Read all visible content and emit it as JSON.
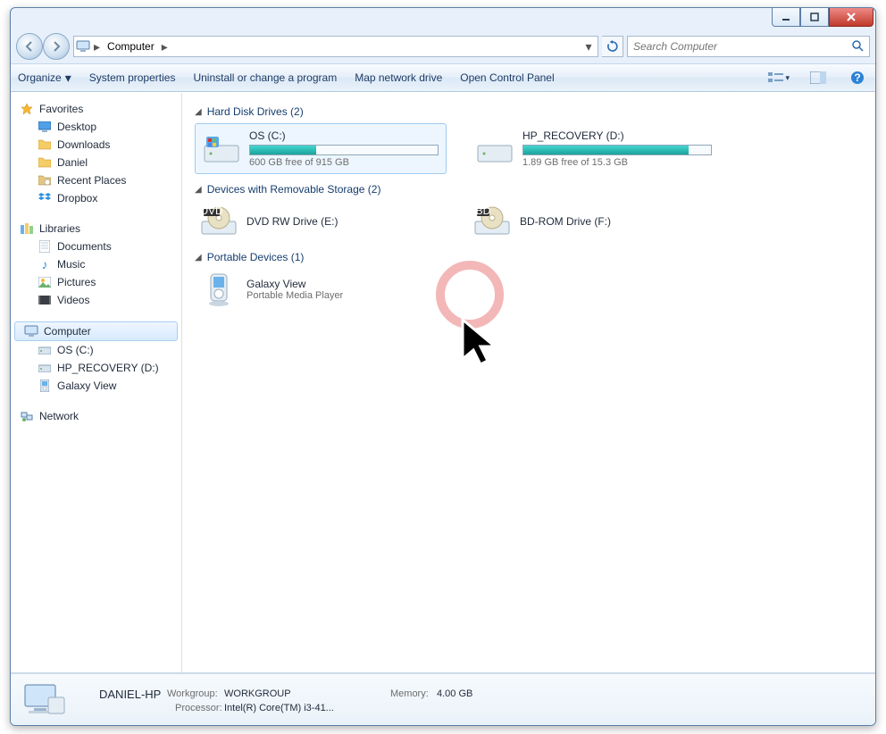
{
  "breadcrumb": {
    "root": "Computer"
  },
  "search": {
    "placeholder": "Search Computer"
  },
  "toolbar": {
    "organize": "Organize",
    "system_properties": "System properties",
    "uninstall": "Uninstall or change a program",
    "map_drive": "Map network drive",
    "control_panel": "Open Control Panel"
  },
  "sidebar": {
    "favorites": {
      "label": "Favorites",
      "items": [
        {
          "label": "Desktop",
          "icon": "desktop"
        },
        {
          "label": "Downloads",
          "icon": "folder"
        },
        {
          "label": "Daniel",
          "icon": "folder"
        },
        {
          "label": "Recent Places",
          "icon": "recent"
        },
        {
          "label": "Dropbox",
          "icon": "dropbox"
        }
      ]
    },
    "libraries": {
      "label": "Libraries",
      "items": [
        {
          "label": "Documents",
          "icon": "documents"
        },
        {
          "label": "Music",
          "icon": "music"
        },
        {
          "label": "Pictures",
          "icon": "pictures"
        },
        {
          "label": "Videos",
          "icon": "videos"
        }
      ]
    },
    "computer": {
      "label": "Computer",
      "items": [
        {
          "label": "OS (C:)",
          "icon": "hdd"
        },
        {
          "label": "HP_RECOVERY (D:)",
          "icon": "hdd"
        },
        {
          "label": "Galaxy View",
          "icon": "media-player"
        }
      ]
    },
    "network": {
      "label": "Network"
    }
  },
  "sections": {
    "hdd": {
      "title": "Hard Disk Drives (2)"
    },
    "removable": {
      "title": "Devices with Removable Storage (2)"
    },
    "portable": {
      "title": "Portable Devices (1)"
    }
  },
  "drives": {
    "os": {
      "title": "OS (C:)",
      "sub": "600 GB free of 915 GB",
      "fill_pct": 35
    },
    "recovery": {
      "title": "HP_RECOVERY (D:)",
      "sub": "1.89 GB free of 15.3 GB",
      "fill_pct": 88
    }
  },
  "removable": {
    "dvd": {
      "title": "DVD RW Drive (E:)"
    },
    "bd": {
      "title": "BD-ROM Drive (F:)"
    }
  },
  "portable": {
    "galaxy": {
      "title": "Galaxy View",
      "sub": "Portable Media Player"
    }
  },
  "details": {
    "name": "DANIEL-HP",
    "workgroup_label": "Workgroup:",
    "workgroup": "WORKGROUP",
    "processor_label": "Processor:",
    "processor": "Intel(R) Core(TM) i3-41...",
    "memory_label": "Memory:",
    "memory": "4.00 GB"
  }
}
